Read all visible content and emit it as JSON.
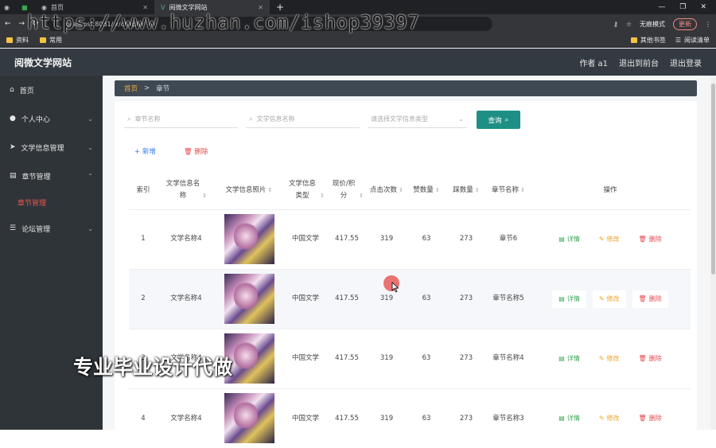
{
  "browser": {
    "tabs": [
      {
        "label": ""
      },
      {
        "label": "首页"
      },
      {
        "label": "阅微文学网站"
      }
    ],
    "url": "localhost:8081/#/chapter",
    "incognito_label": "无痕模式",
    "update_label": "更新",
    "bookmarks": [
      "资料",
      "常用"
    ],
    "bookmarks_right": [
      "其他书签",
      "阅读清单"
    ]
  },
  "watermark": "https://www.huzhan.com/ishop39397",
  "caption": "专业毕业设计代做",
  "app": {
    "title": "阅微文学网站",
    "header_links": [
      "作者 a1",
      "退出到前台",
      "退出登录"
    ]
  },
  "sidebar": {
    "items": [
      {
        "label": "首页",
        "icon": "home-icon"
      },
      {
        "label": "个人中心",
        "icon": "user-icon"
      },
      {
        "label": "文学信息管理",
        "icon": "send-icon"
      },
      {
        "label": "章节管理",
        "icon": "list-icon"
      },
      {
        "label": "论坛管理",
        "icon": "menu-icon"
      }
    ],
    "sub_item": "章节管理"
  },
  "breadcrumb": {
    "home": "首页",
    "sep": ">",
    "current": "章节"
  },
  "search": {
    "chapter_placeholder": "章节名称",
    "title_placeholder": "文学信息名称",
    "type_placeholder": "请选择文学信息类型",
    "button_label": "查询"
  },
  "actions": {
    "add_label": "新增",
    "delete_label": "删除"
  },
  "table": {
    "headers": [
      "索引",
      "文学信息名称",
      "文学信息照片",
      "文学信息类型",
      "现价/积分",
      "点击次数",
      "赞数量",
      "踩数量",
      "章节名称",
      "操作"
    ],
    "rows": [
      {
        "index": "1",
        "name": "文学名称4",
        "type": "中国文学",
        "price": "417.55",
        "clicks": "319",
        "likes": "63",
        "dislikes": "273",
        "chapter": "章节6"
      },
      {
        "index": "2",
        "name": "文学名称4",
        "type": "中国文学",
        "price": "417.55",
        "clicks": "319",
        "likes": "63",
        "dislikes": "273",
        "chapter": "章节名称5"
      },
      {
        "index": "3",
        "name": "文学名称4",
        "type": "中国文学",
        "price": "417.55",
        "clicks": "319",
        "likes": "63",
        "dislikes": "273",
        "chapter": "章节名称4"
      },
      {
        "index": "4",
        "name": "文学名称4",
        "type": "中国文学",
        "price": "417.55",
        "clicks": "319",
        "likes": "63",
        "dislikes": "273",
        "chapter": "章节名称3"
      }
    ],
    "op_detail": "详情",
    "op_edit": "修改",
    "op_delete": "删除"
  }
}
